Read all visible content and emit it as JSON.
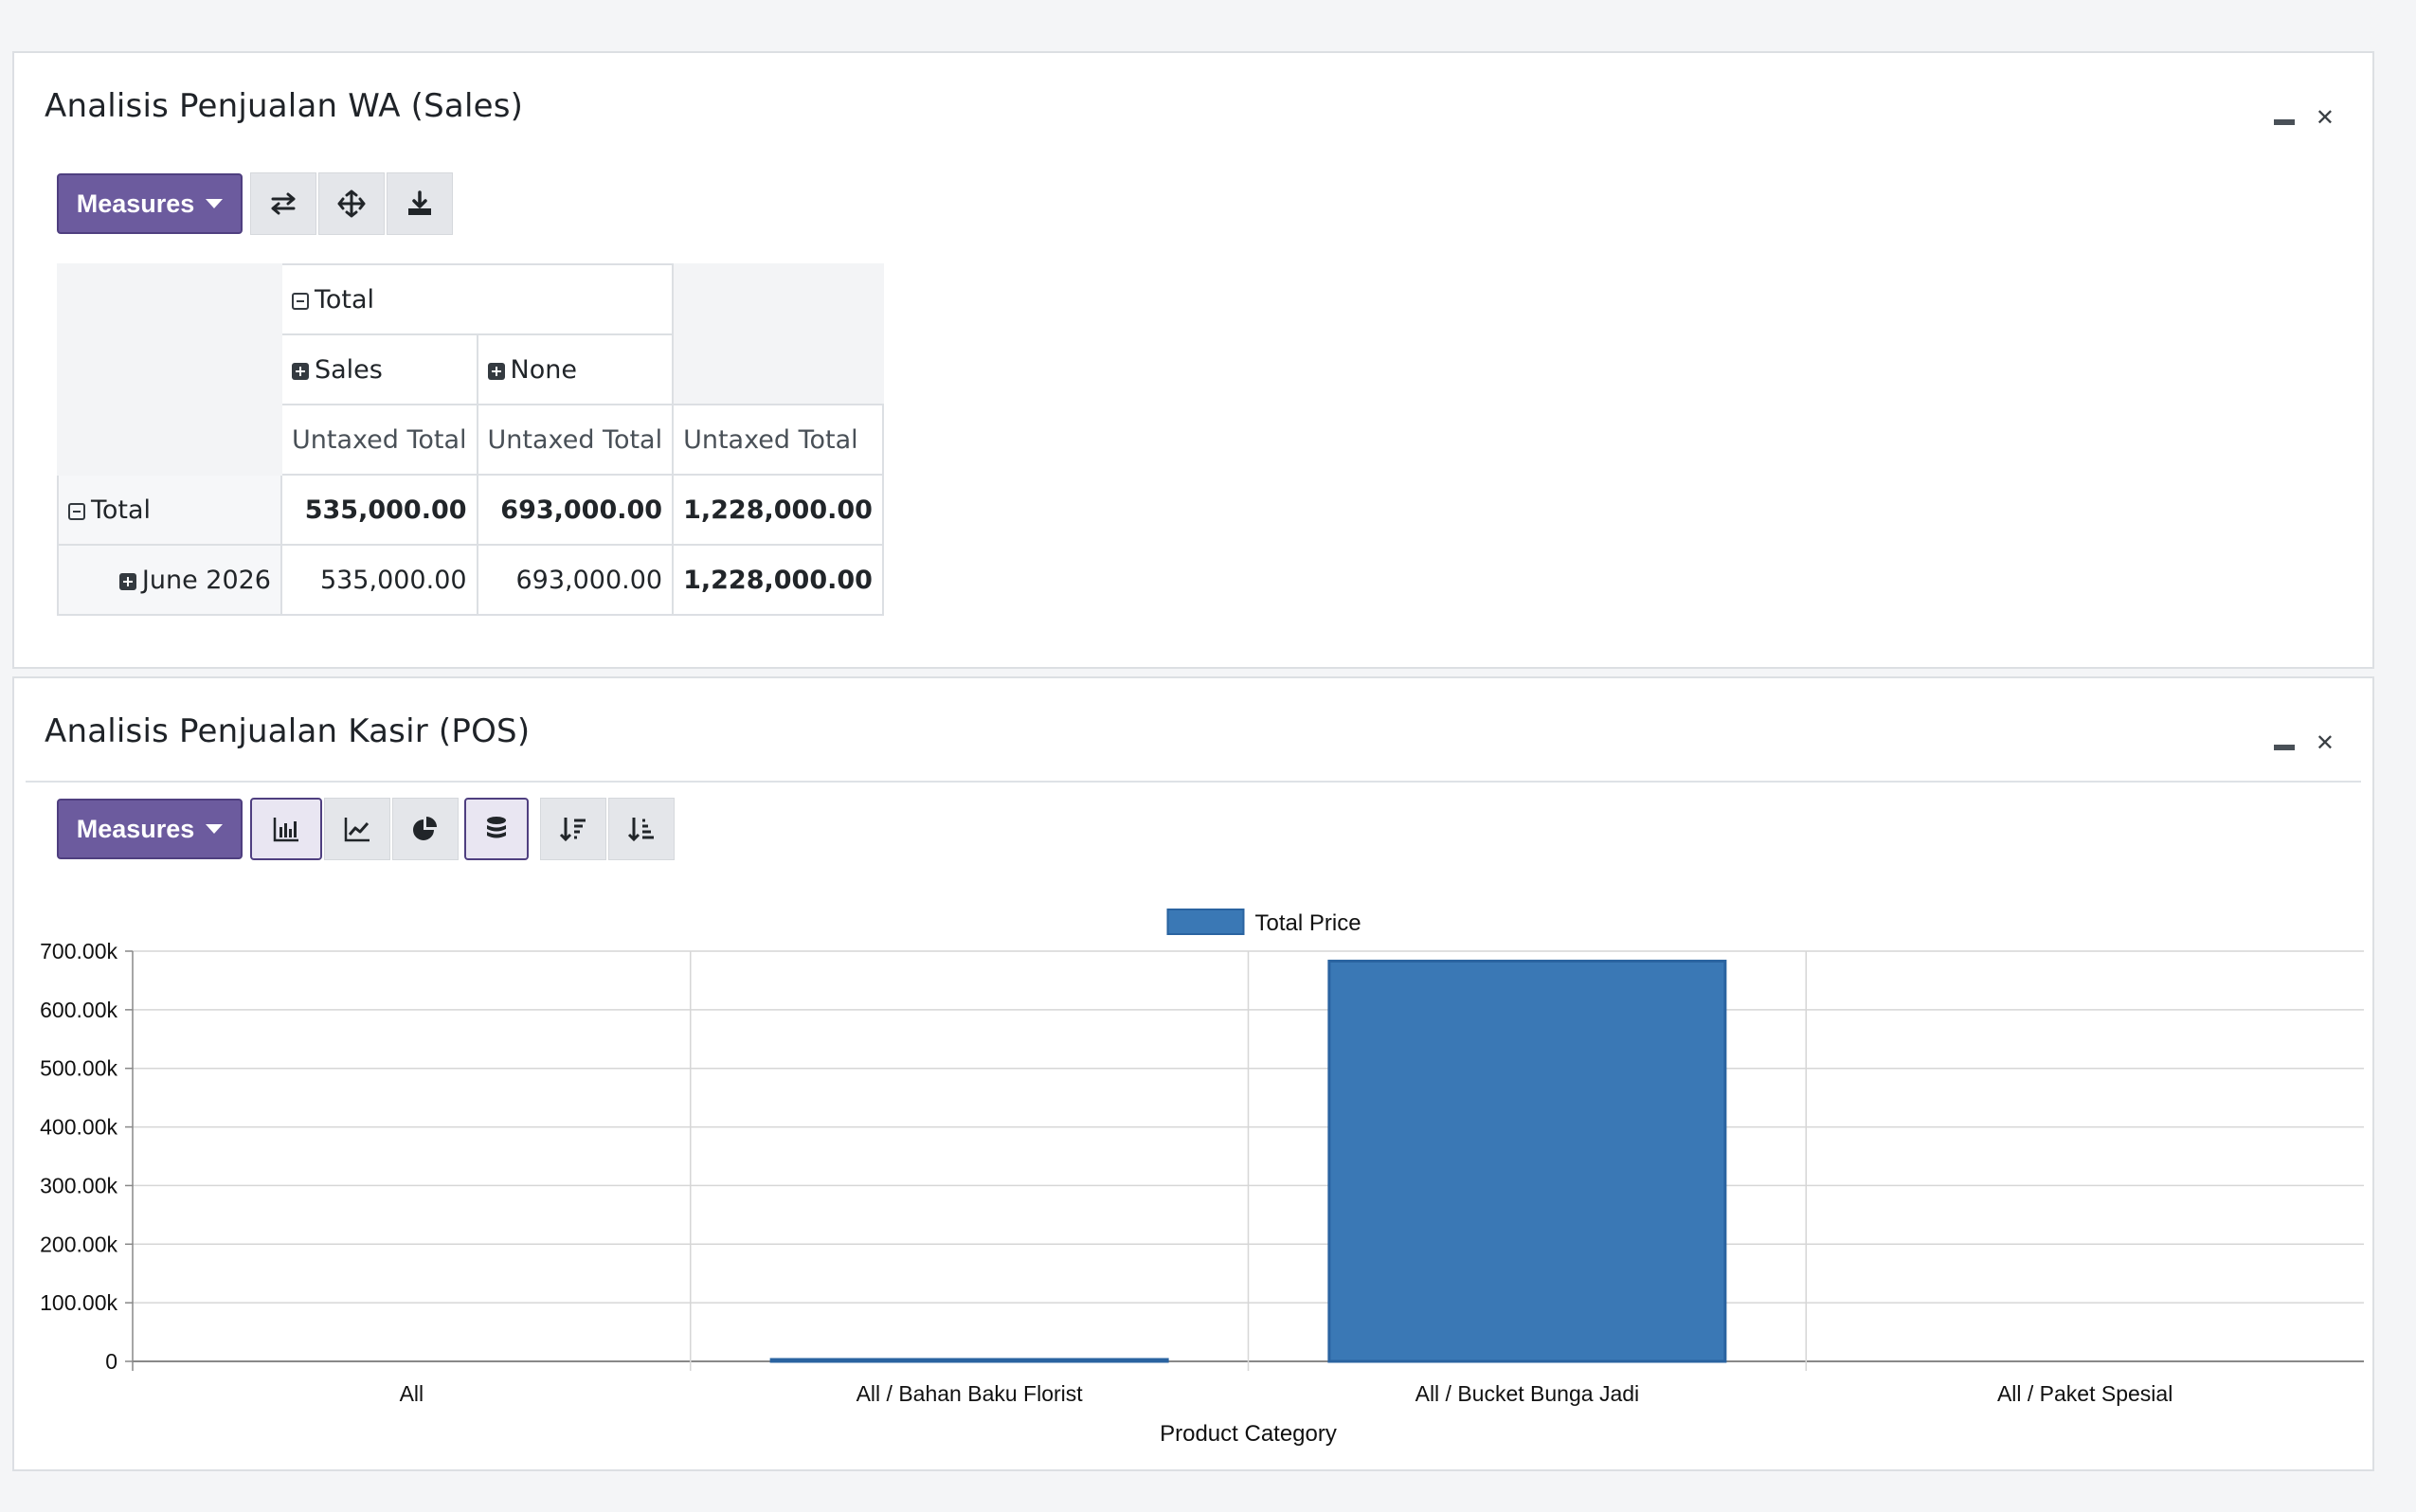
{
  "sales_panel": {
    "title": "Analisis Penjualan WA (Sales)",
    "measures_label": "Measures",
    "toolbar_icons": [
      "flip-axis-icon",
      "expand-all-icon",
      "download-icon"
    ],
    "pivot": {
      "col_total_label": "Total",
      "col_groups": [
        "Sales",
        "None"
      ],
      "measure_label": "Untaxed Total",
      "rows": [
        {
          "label": "Total",
          "expand": "minus",
          "values": [
            "535,000.00",
            "693,000.00",
            "1,228,000.00"
          ]
        },
        {
          "label": "June 2026",
          "expand": "plus",
          "values": [
            "535,000.00",
            "693,000.00",
            "1,228,000.00"
          ]
        }
      ]
    }
  },
  "pos_panel": {
    "title": "Analisis Penjualan Kasir (POS)",
    "measures_label": "Measures",
    "toolbar_icons": [
      "bar-chart-icon",
      "line-chart-icon",
      "pie-chart-icon",
      "stacked-icon",
      "sort-descending-icon",
      "sort-ascending-icon"
    ],
    "active_tools": [
      "bar-chart-icon",
      "stacked-icon"
    ]
  },
  "chart_data": {
    "type": "bar",
    "categories": [
      "All",
      "All / Bahan Baku Florist",
      "All / Bucket Bunga Jadi",
      "All / Paket Spesial"
    ],
    "series": [
      {
        "name": "Total Price",
        "values": [
          0,
          3000,
          683000,
          0
        ],
        "color": "#3a78b5"
      }
    ],
    "xlabel": "Product Category",
    "ylabel": "",
    "ylim": [
      0,
      700000
    ],
    "yticks": [
      "0",
      "100.00k",
      "200.00k",
      "300.00k",
      "400.00k",
      "500.00k",
      "600.00k",
      "700.00k"
    ],
    "grid": true,
    "legend": "top-center"
  },
  "colors": {
    "accent": "#6c5b9e",
    "bar": "#3a78b5"
  }
}
